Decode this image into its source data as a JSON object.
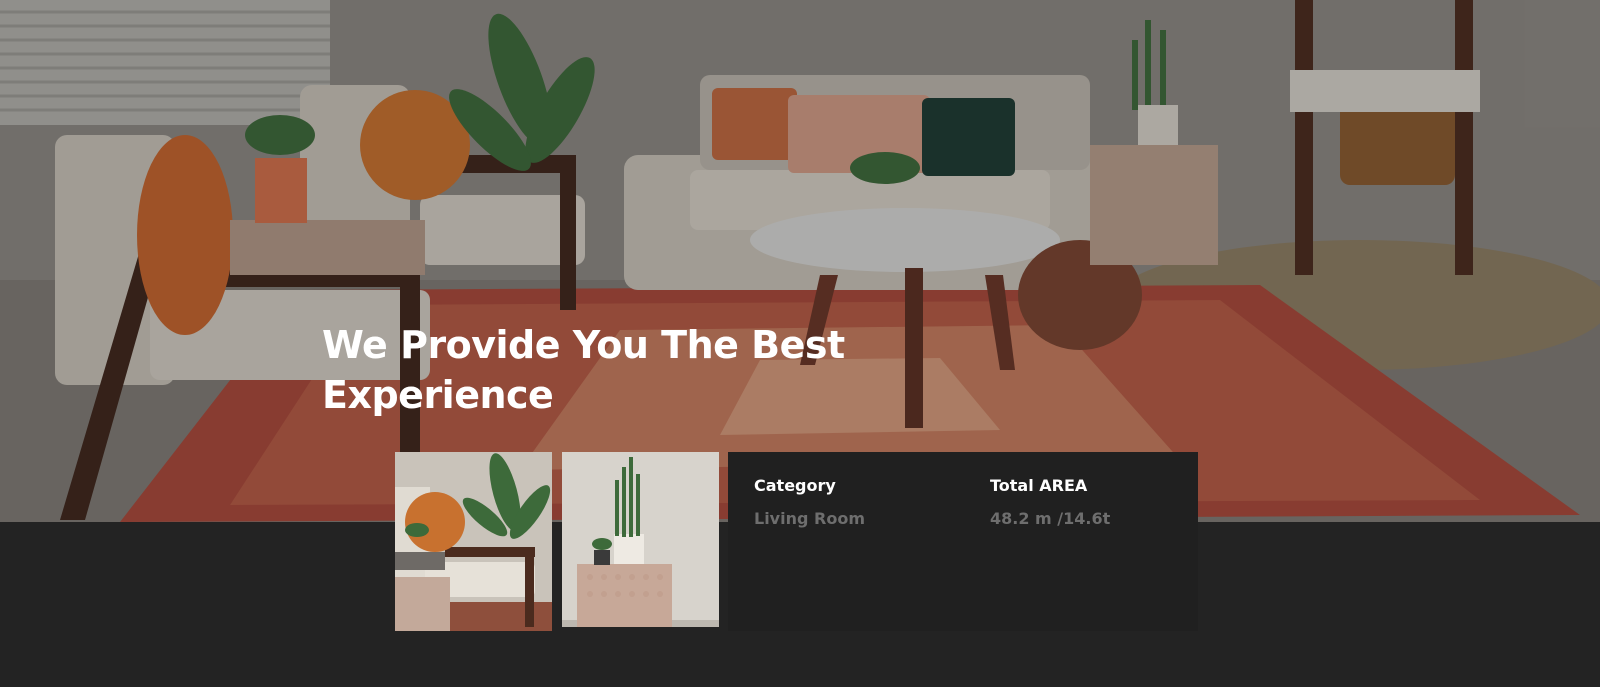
{
  "hero": {
    "title": "We Provide You The Best Experience",
    "image": "living-room-photo"
  },
  "gallery": {
    "thumbnails": [
      {
        "image": "armchair-with-plant-photo"
      },
      {
        "image": "snake-plant-on-side-table-photo"
      }
    ]
  },
  "details": {
    "category_label": "Category",
    "category_value": "Living Room",
    "area_label": "Total AREA",
    "area_value": "48.2 m /14.6t"
  },
  "colors": {
    "background": "#232323",
    "panel": "#202020",
    "heading": "#ffffff",
    "muted_value": "#6e6e6e",
    "rug": "#a9483a"
  }
}
